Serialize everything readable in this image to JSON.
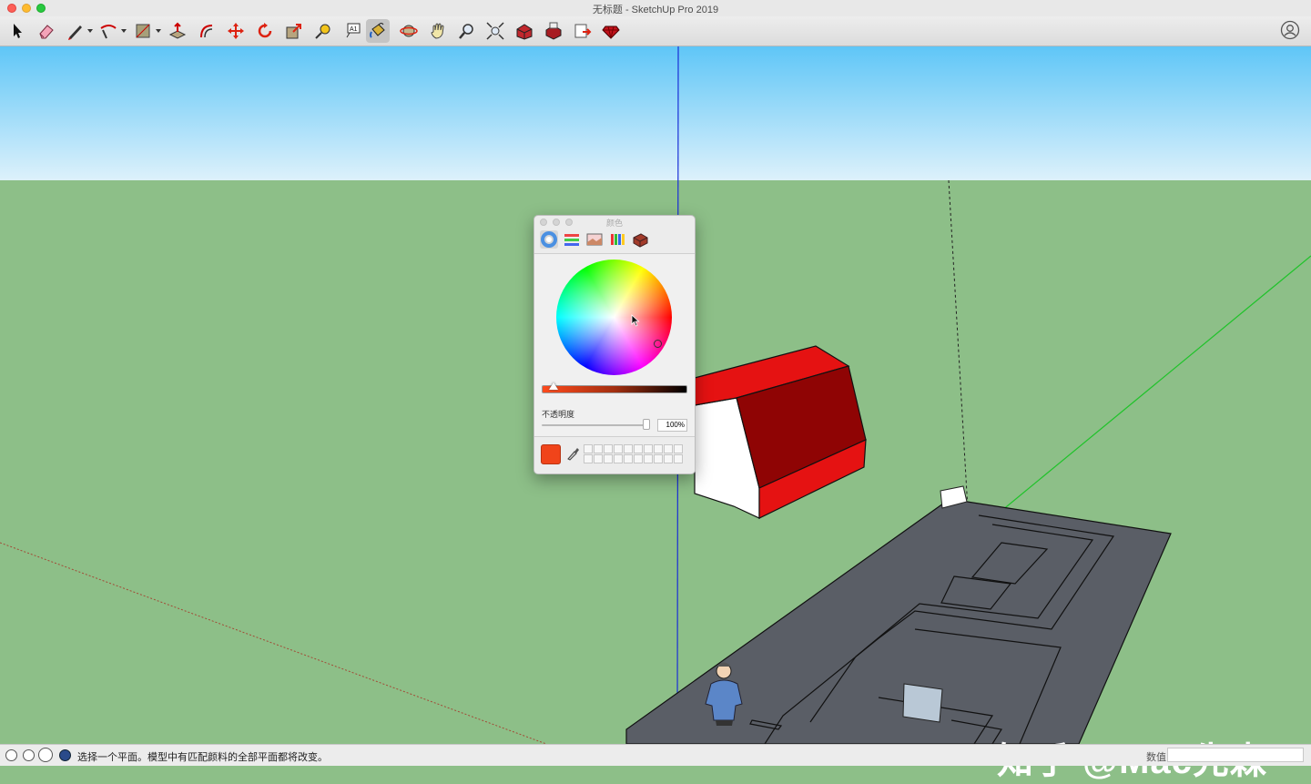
{
  "window": {
    "title": "无标题 - SketchUp Pro 2019"
  },
  "toolbar": {
    "tools": [
      {
        "name": "select-tool",
        "icon": "arrow-icon"
      },
      {
        "name": "eraser-tool",
        "icon": "eraser-icon"
      },
      {
        "name": "line-tool",
        "icon": "pencil-icon"
      },
      {
        "name": "arc-tool",
        "icon": "arc-icon"
      },
      {
        "name": "shape-tool",
        "icon": "rectangle-icon"
      },
      {
        "name": "push-pull-tool",
        "icon": "push-pull-icon"
      },
      {
        "name": "offset-tool",
        "icon": "offset-icon"
      },
      {
        "name": "move-tool",
        "icon": "move-icon"
      },
      {
        "name": "rotate-tool",
        "icon": "rotate-icon"
      },
      {
        "name": "scale-tool",
        "icon": "scale-icon"
      },
      {
        "name": "tape-measure-tool",
        "icon": "tape-measure-icon"
      },
      {
        "name": "text-tool",
        "icon": "text-icon"
      },
      {
        "name": "paint-bucket-tool",
        "icon": "paint-bucket-icon"
      },
      {
        "name": "orbit-tool",
        "icon": "orbit-icon"
      },
      {
        "name": "pan-tool",
        "icon": "hand-icon"
      },
      {
        "name": "zoom-tool",
        "icon": "magnifier-icon"
      },
      {
        "name": "zoom-extents-tool",
        "icon": "zoom-extents-icon"
      },
      {
        "name": "warehouse-tool",
        "icon": "warehouse-icon"
      },
      {
        "name": "extension-warehouse-tool",
        "icon": "extension-warehouse-icon"
      },
      {
        "name": "layout-send-tool",
        "icon": "send-to-layout-icon"
      },
      {
        "name": "extension-manager-tool",
        "icon": "ruby-icon"
      }
    ],
    "text_tool_label": "A1"
  },
  "color_panel": {
    "title": "颜色",
    "opacity_label": "不透明度",
    "opacity_value": "100%",
    "current_color": "#f0441a",
    "opacity_percent": 100
  },
  "statusbar": {
    "message": "选择一个平面。模型中有匹配颜料的全部平面都将改变。",
    "measure_label": "数值"
  },
  "watermark": {
    "text": "知乎 @Mac先森"
  },
  "colors": {
    "sky_top": "#5fc6f7",
    "sky_bottom": "#ddf1fb",
    "ground": "#8dbf88",
    "roof_red": "#e51212",
    "roof_dark": "#8f0404",
    "slab": "#5a5e66"
  }
}
